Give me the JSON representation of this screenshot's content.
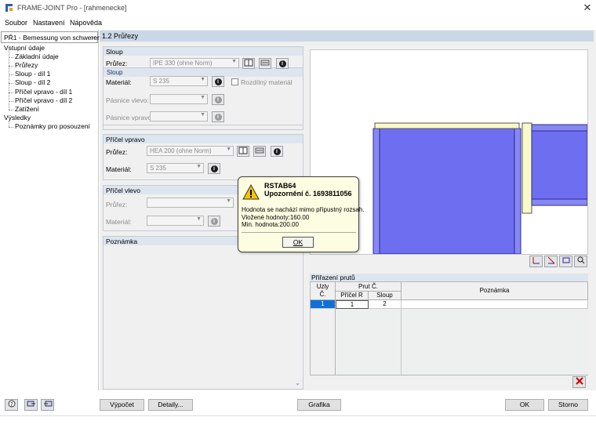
{
  "window": {
    "title": "FRAME-JOINT Pro - [rahmenecke]",
    "close_glyph": "✕"
  },
  "menu": [
    "Soubor",
    "Nastavení",
    "Nápověda"
  ],
  "nav": {
    "selected_case": "PŘ1 - Bemessung von schwerer",
    "tree": [
      {
        "label": "Vstupní údaje",
        "level": 0
      },
      {
        "label": "Základní údaje",
        "level": 1
      },
      {
        "label": "Průřezy",
        "level": 1
      },
      {
        "label": "Sloup - díl 1",
        "level": 1
      },
      {
        "label": "Sloup - díl 2",
        "level": 1
      },
      {
        "label": "Příčel vpravo - díl 1",
        "level": 1
      },
      {
        "label": "Příčel vpravo - díl 2",
        "level": 1
      },
      {
        "label": "Zatížení",
        "level": 1
      },
      {
        "label": "Výsledky",
        "level": 0
      },
      {
        "label": "Poznámky pro posouzení",
        "level": 1
      }
    ]
  },
  "section_title": "1.2 Průřezy",
  "sloup": {
    "title": "Sloup",
    "prurez_label": "Průřez:",
    "prurez_value": "IPE 330 (ohne Norm)",
    "material_label": "Materiál:",
    "material_value": "S 235",
    "rozdilny_label": "Rozdílný materiál",
    "pasnice_vlevo_label": "Pásnice vlevo:",
    "pasnice_vpravo_label": "Pásnice vpravo:"
  },
  "pricel_vpravo": {
    "title": "Příčel vpravo",
    "prurez_label": "Průřez:",
    "prurez_value": "HEA 200 (ohne Norm)",
    "material_label": "Materiál:",
    "material_value": "S 235"
  },
  "pricel_vlevo": {
    "title": "Příčel vlevo",
    "prurez_label": "Průřez:",
    "material_label": "Materiál:"
  },
  "poznamka_title": "Poznámka",
  "prirazeni": {
    "title": "Přiřazení prutů",
    "headers": {
      "uzly": "Uzly",
      "uzly_sub": "Č.",
      "prut": "Prut Č.",
      "pricel_r": "Příčel R",
      "sloup": "Sloup",
      "poznamka": "Poznámka"
    },
    "rows": [
      {
        "uzly": "1",
        "pricel_r": "1",
        "sloup": "2",
        "poznamka": ""
      }
    ]
  },
  "dialog": {
    "source": "RSTAB64",
    "heading": "Upozornění č. 1693811056",
    "line1": "Hodnota se nachází mimo přípustný rozsah.",
    "line2": "Vložené hodnoty:160.00",
    "line3": "Min. hodnota:200.00",
    "ok_label": "OK"
  },
  "buttons": {
    "vypocet": "Výpočet",
    "detaily": "Detaily...",
    "grafika": "Grafika",
    "ok": "OK",
    "storno": "Storno"
  },
  "colors": {
    "accent": "#cad7e6",
    "section_head": "#dde5ee",
    "beam_blue": "#6e6ef0",
    "flange_yellow": "#fafac8",
    "dialog_bg": "#fdfde2"
  }
}
